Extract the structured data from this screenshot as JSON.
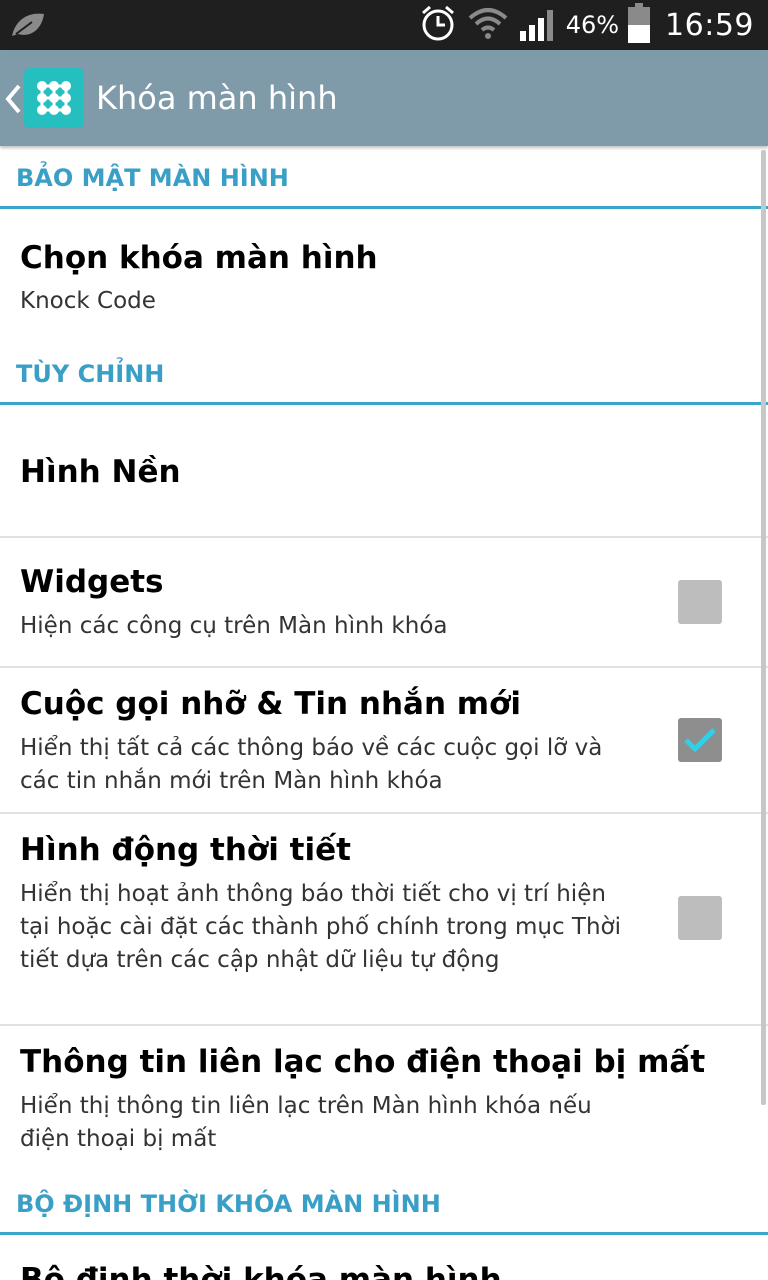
{
  "status_bar": {
    "battery": "46%",
    "time": "16:59"
  },
  "action_bar": {
    "title": "Khóa màn hình"
  },
  "sections": [
    {
      "header": "BẢO MẬT MÀN HÌNH"
    },
    {
      "header": "TÙY CHỈNH"
    },
    {
      "header": "BỘ ĐỊNH THỜI KHÓA MÀN HÌNH"
    }
  ],
  "items": {
    "choose_lock": {
      "title": "Chọn khóa màn hình",
      "summary": "Knock Code"
    },
    "wallpaper": {
      "title": "Hình Nền"
    },
    "widgets": {
      "title": "Widgets",
      "summary": "Hiện các công cụ trên Màn hình khóa",
      "checked": false
    },
    "missed": {
      "title": "Cuộc gọi nhỡ & Tin nhắn mới",
      "summary": "Hiển thị tất cả các thông báo về các cuộc gọi lỡ và các tin nhắn mới trên Màn hình khóa",
      "checked": true
    },
    "weather": {
      "title": "Hình động thời tiết",
      "summary": "Hiển thị hoạt ảnh thông báo thời tiết cho vị trí hiện tại hoặc cài đặt các thành phố chính trong mục Thời tiết dựa trên các cập nhật dữ liệu tự động",
      "checked": false
    },
    "lost_phone": {
      "title": "Thông tin liên lạc cho điện thoại bị mất",
      "summary": "Hiển thị thông tin liên lạc trên Màn hình khóa nếu điện thoại bị mất"
    },
    "lock_timer": {
      "title": "Bộ định thời khóa màn hình"
    }
  },
  "colors": {
    "accent": "#3aa6c9",
    "action_bar": "#7f9aa8",
    "status_bar": "#1f1f1f",
    "check": "#30d0e8"
  }
}
